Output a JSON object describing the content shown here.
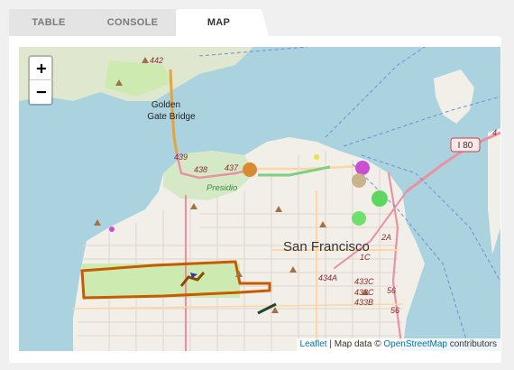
{
  "tabs": [
    {
      "label": "TABLE",
      "active": false
    },
    {
      "label": "CONSOLE",
      "active": false
    },
    {
      "label": "MAP",
      "active": true
    }
  ],
  "map": {
    "zoom_in": "+",
    "zoom_out": "−",
    "labels": {
      "city": "San Francisco",
      "bridge_line1": "Golden",
      "bridge_line2": "Gate Bridge",
      "presidio": "Presidio",
      "i80": "I 80"
    },
    "route_labels": [
      "442",
      "4",
      "439",
      "438",
      "437",
      "1C",
      "2A",
      "434A",
      "433C",
      "433C",
      "433B",
      "56",
      "56"
    ],
    "attribution": {
      "leaflet": "Leaflet",
      "separator": " | Map data © ",
      "osm": "OpenStreetMap",
      "suffix": " contributors"
    }
  }
}
